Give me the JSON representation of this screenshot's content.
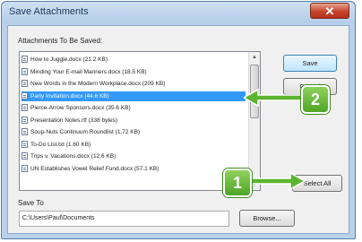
{
  "window": {
    "title": "Save Attachments",
    "close_glyph": "✕"
  },
  "dialog": {
    "attachments_label": "Attachments To Be Saved:",
    "attachments": [
      {
        "label": "How to Juggle.docx (21.2 KB)",
        "selected": false
      },
      {
        "label": "Minding Your E-mail Manners.docx (18.5 KB)",
        "selected": false
      },
      {
        "label": "New Words in the Modern Workplace.docx (209 KB)",
        "selected": false
      },
      {
        "label": "Party Invitation.docx (44.6 KB)",
        "selected": true
      },
      {
        "label": "Pierce-Arrow Sponsors.docx (35.6 KB)",
        "selected": false
      },
      {
        "label": "Presentation Notes.rtf (338 bytes)",
        "selected": false
      },
      {
        "label": "Soup-Nuts Continuum Roundlist (1.72 KB)",
        "selected": false
      },
      {
        "label": "To-Do List.txt (1.60 KB)",
        "selected": false
      },
      {
        "label": "Trips v. Vacations.docx (12.6 KB)",
        "selected": false
      },
      {
        "label": "UN Establishes Vowel Relief Fund.docx (57.1 KB)",
        "selected": false
      }
    ],
    "save_button": "Save",
    "cancel_button": "Cancel",
    "select_all_button": "Select All",
    "save_to_label": "Save To",
    "save_to_value": "C:\\Users\\Paul\\Documents",
    "browse_button": "Browse..."
  },
  "callouts": {
    "step1": "1",
    "step2": "2",
    "color": "#5bb52f"
  },
  "colors": {
    "selection": "#3399ff",
    "title_bar": "#b9d1ea",
    "close_button": "#c7442b"
  }
}
